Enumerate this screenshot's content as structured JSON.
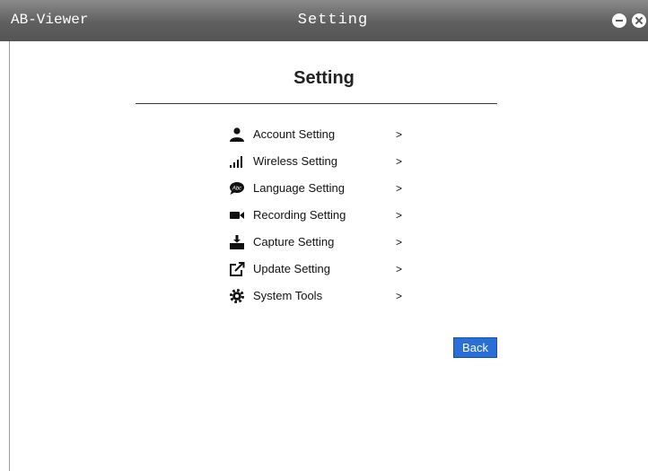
{
  "window": {
    "app_name": "AB-Viewer",
    "title": "Setting",
    "controls": {
      "minimize_icon": "minimize-icon",
      "close_icon": "close-icon"
    }
  },
  "page": {
    "heading": "Setting"
  },
  "menu": {
    "items": [
      {
        "label": "Account Setting",
        "chevron": ">",
        "icon": "user-icon"
      },
      {
        "label": "Wireless Setting",
        "chevron": ">",
        "icon": "signal-icon"
      },
      {
        "label": "Language Setting",
        "chevron": ">",
        "icon": "language-icon"
      },
      {
        "label": "Recording Setting",
        "chevron": ">",
        "icon": "video-camera-icon"
      },
      {
        "label": "Capture Setting",
        "chevron": ">",
        "icon": "capture-icon"
      },
      {
        "label": "Update Setting",
        "chevron": ">",
        "icon": "external-link-icon"
      },
      {
        "label": "System Tools",
        "chevron": ">",
        "icon": "gear-icon"
      }
    ]
  },
  "actions": {
    "back_label": "Back"
  },
  "colors": {
    "titlebar": "#5f5f5f",
    "accent": "#2a6fd8",
    "text": "#111111"
  }
}
